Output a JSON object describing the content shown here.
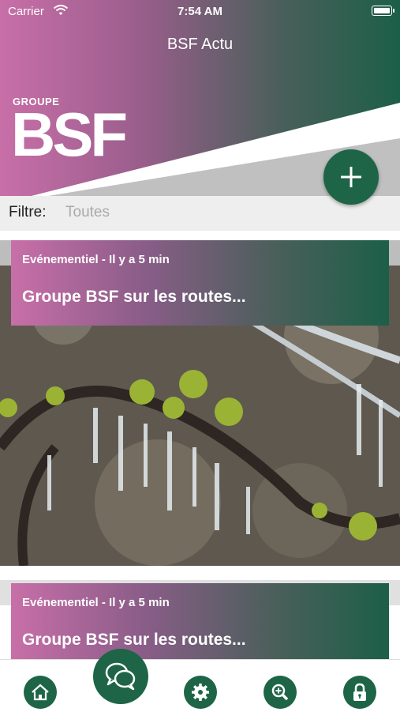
{
  "status_bar": {
    "carrier": "Carrier",
    "time": "7:54 AM"
  },
  "nav": {
    "title": "BSF Actu"
  },
  "logo": {
    "small": "GROUPE",
    "big": "BSF"
  },
  "filter": {
    "label": "Filtre:",
    "value": "Toutes"
  },
  "feed": {
    "items": [
      {
        "category": "Evénementiel - Il y a 5 min",
        "title": "Groupe BSF sur les routes..."
      },
      {
        "category": "Evénementiel - Il y a 5 min",
        "title": "Groupe BSF sur les routes..."
      }
    ]
  },
  "colors": {
    "accent_green": "#1d6546",
    "gradient_pink": "#c86fa8"
  },
  "tabbar": {
    "icons": [
      "home-icon",
      "chat-icon",
      "gear-icon",
      "zoom-icon",
      "lock-icon"
    ]
  }
}
